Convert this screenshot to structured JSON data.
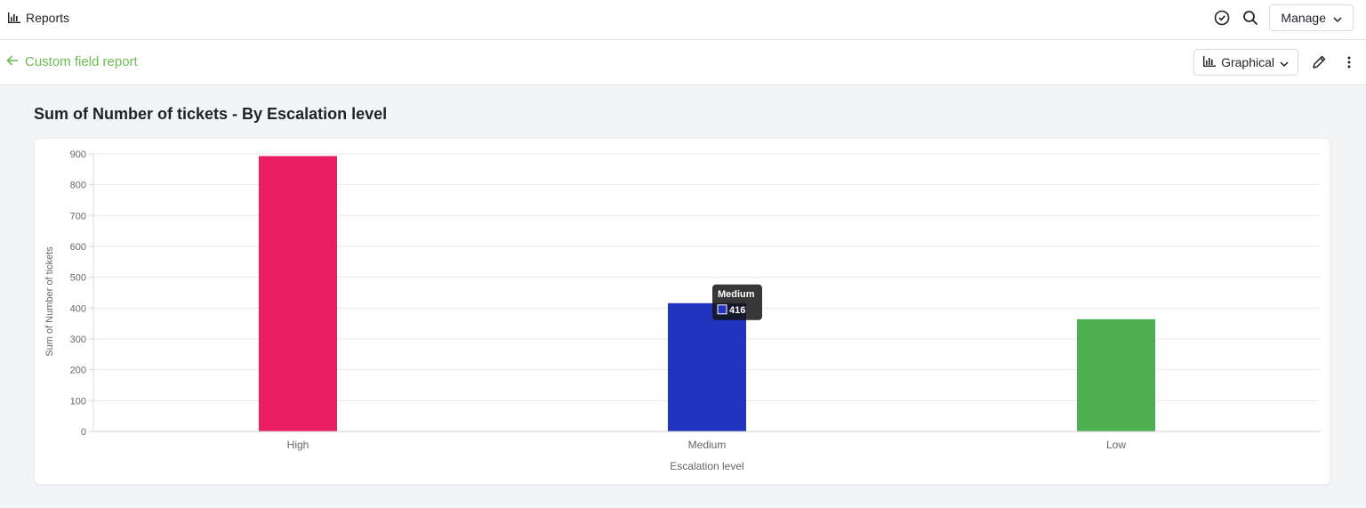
{
  "header": {
    "app_title": "Reports",
    "manage_label": "Manage"
  },
  "subheader": {
    "back_label": "Custom field report",
    "view_label": "Graphical"
  },
  "report": {
    "title": "Sum of Number of tickets - By Escalation level"
  },
  "colors": {
    "accent_green": "#6dbb53",
    "bar_high": "#e91e63",
    "bar_medium": "#2133bf",
    "bar_low": "#4caf50"
  },
  "icons": [
    "bar-chart-icon",
    "clock-check-icon",
    "search-icon",
    "chevron-down-icon",
    "arrow-left-icon",
    "pencil-icon",
    "more-vertical-icon"
  ],
  "chart_data": {
    "type": "bar",
    "categories": [
      "High",
      "Medium",
      "Low"
    ],
    "values": [
      893,
      416,
      364
    ],
    "xlabel": "Escalation level",
    "ylabel": "Sum of Number of tickets",
    "ylim": [
      0,
      900
    ],
    "yticks": [
      0,
      100,
      200,
      300,
      400,
      500,
      600,
      700,
      800,
      900
    ],
    "grid": true,
    "bar_colors": [
      "#e91e63",
      "#2133bf",
      "#4caf50"
    ],
    "tooltip": {
      "category": "Medium",
      "value": "416"
    }
  }
}
